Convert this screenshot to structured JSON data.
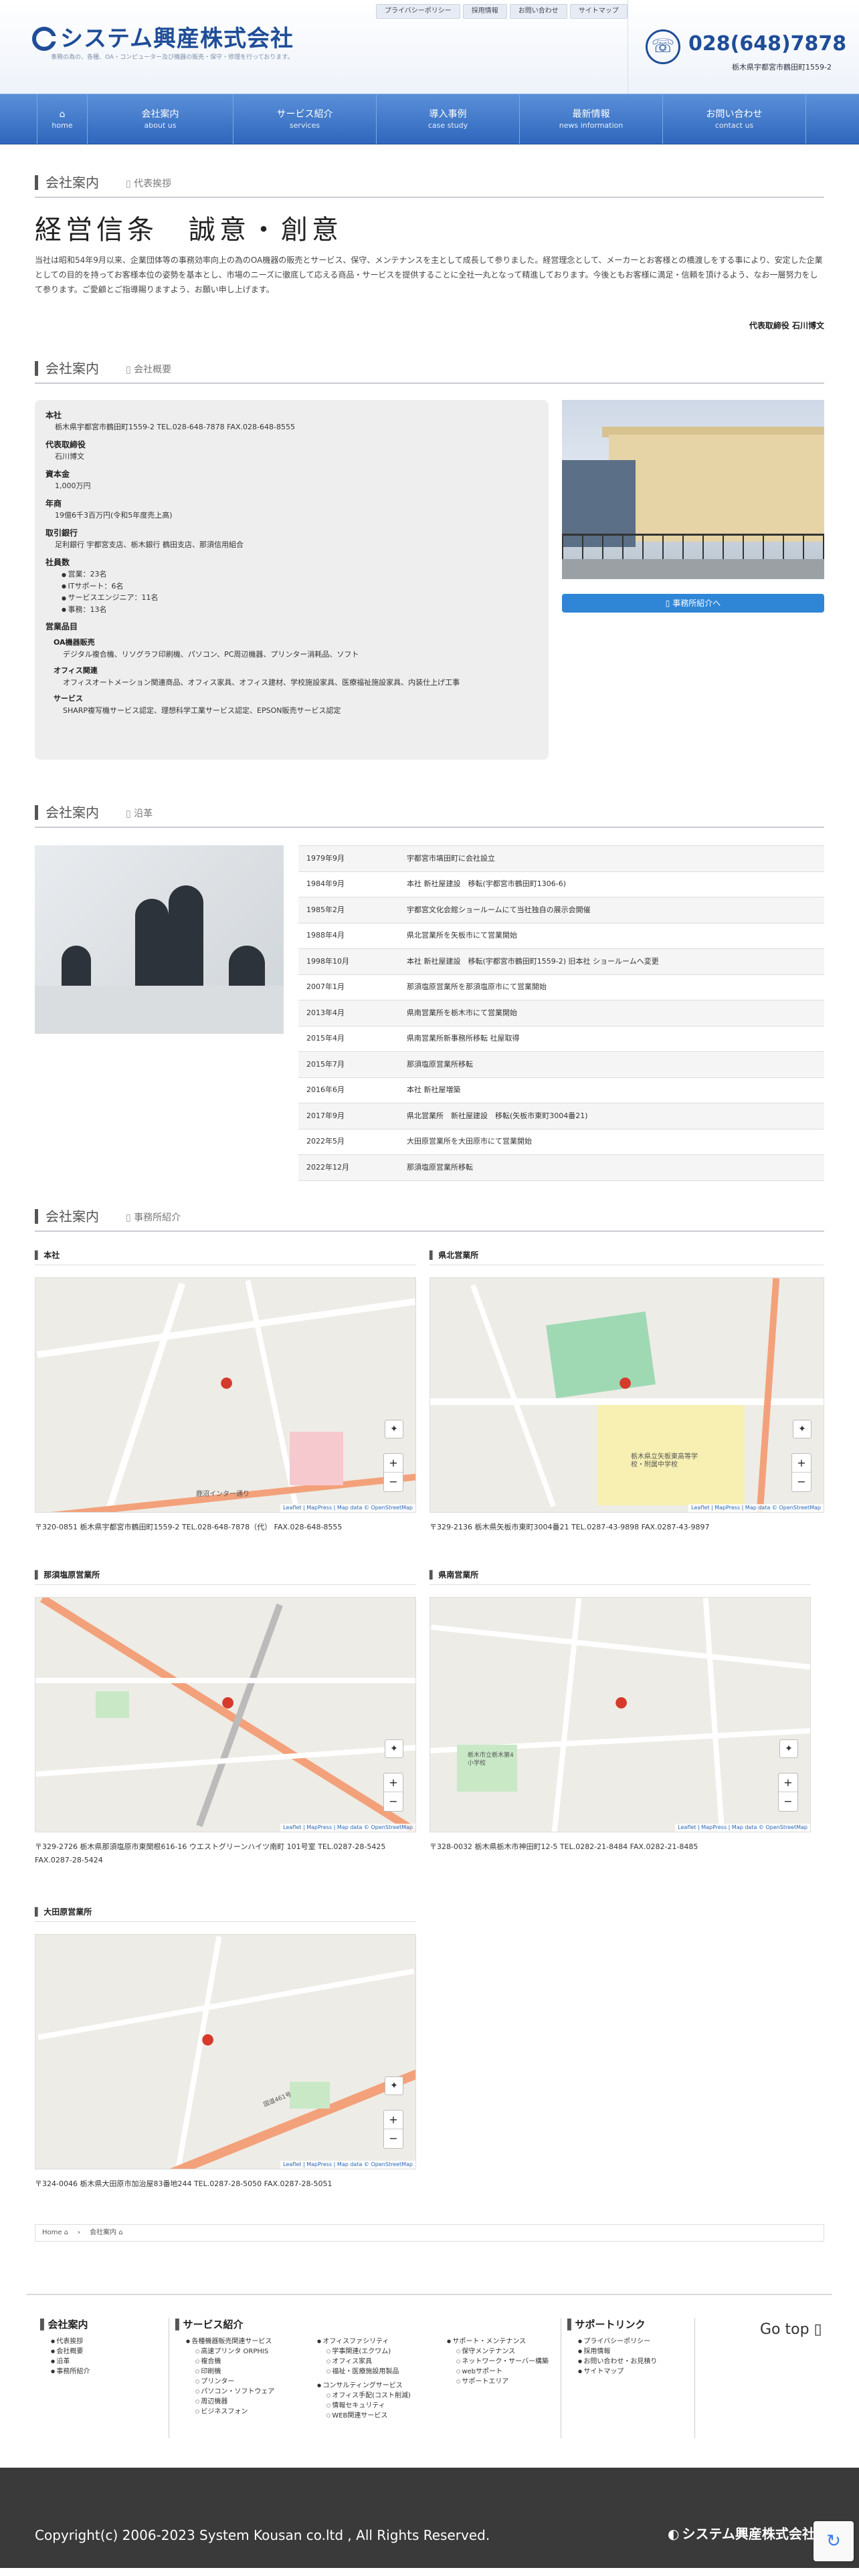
{
  "header": {
    "logo_text": "システム興産株式会社",
    "tagline": "事務の為の、各種、OA・コンピューター及び機器の販売・保守・修理を行っております。",
    "util_nav": [
      "プライバシーポリシー",
      "採用情報",
      "お問い合わせ",
      "サイトマップ"
    ],
    "tel_number": "028(648)7878",
    "tel_address": "栃木県宇都宮市鶴田町1559-2"
  },
  "gnav": [
    {
      "jp": "",
      "en": "home"
    },
    {
      "jp": "会社案内",
      "en": "about us"
    },
    {
      "jp": "サービス紹介",
      "en": "services"
    },
    {
      "jp": "導入事例",
      "en": "case study"
    },
    {
      "jp": "最新情報",
      "en": "news information"
    },
    {
      "jp": "お問い合わせ",
      "en": "contact us"
    }
  ],
  "greeting": {
    "heading": "会社案内",
    "sub": "代表挨拶",
    "motto": "経営信条　誠意・創意",
    "body": "当社は昭和54年9月以来、企業団体等の事務効率向上の為のOA機器の販売とサービス、保守、メンテナンスを主として成長して参りました。経営理念として、メーカーとお客様との橋渡しをする事により、安定した企業としての目的を持ってお客様本位の姿勢を基本とし、市場のニーズに徹底して応える商品・サービスを提供することに全社一丸となって精進しております。今後ともお客様に満足・信頼を頂けるよう、なお一層努力をして参ります。ご愛顧とご指導賜りますよう、お願い申し上げます。",
    "signature": "代表取締役 石川博文"
  },
  "profile": {
    "heading": "会社案内",
    "sub": "会社概要",
    "head_office_label": "本社",
    "head_office": "栃木県宇都宮市鶴田町1559-2 TEL.028-648-7878 FAX.028-648-8555",
    "ceo_label": "代表取締役",
    "ceo": "石川博文",
    "capital_label": "資本金",
    "capital": "1,000万円",
    "sales_label": "年商",
    "sales": "19億6千3百万円(令和5年度売上高)",
    "banks_label": "取引銀行",
    "banks": "足利銀行 宇都宮支店、栃木銀行 鶴田支店、那須信用組合",
    "staff_label": "社員数",
    "staff": [
      "営業：23名",
      "ITサポート：6名",
      "サービスエンジニア：11名",
      "事務：13名"
    ],
    "products_label": "営業品目",
    "oa_label": "OA機器販売",
    "oa": "デジタル複合機、リソグラフ印刷機、パソコン、PC周辺機器、プリンター消耗品、ソフト",
    "office_label": "オフィス関連",
    "office": "オフィスオートメーション関連商品、オフィス家具、オフィス建材、学校施設家具、医療福祉施設家具、内装仕上げ工事",
    "service_label": "サービス",
    "service": "SHARP複写機サービス認定、理想科学工業サービス認定、EPSON販売サービス認定",
    "office_button": "▯ 事務所紹介へ"
  },
  "history": {
    "heading": "会社案内",
    "sub": "沿革",
    "rows": [
      {
        "date": "1979年9月",
        "event": "宇都宮市塙田町に会社設立"
      },
      {
        "date": "1984年9月",
        "event": "本社 新社屋建設　移転(宇都宮市鶴田町1306-6)"
      },
      {
        "date": "1985年2月",
        "event": "宇都宮文化会館ショールームにて当社独自の展示会開催"
      },
      {
        "date": "1988年4月",
        "event": "県北営業所を矢板市にて営業開始"
      },
      {
        "date": "1998年10月",
        "event": "本社 新社屋建設　移転(宇都宮市鶴田町1559-2) 旧本社 ショールームへ変更"
      },
      {
        "date": "2007年1月",
        "event": "那須塩原営業所を那須塩原市にて営業開始"
      },
      {
        "date": "2013年4月",
        "event": "県南営業所を栃木市にて営業開始"
      },
      {
        "date": "2015年4月",
        "event": "県南営業所新事務所移転 社屋取得"
      },
      {
        "date": "2015年7月",
        "event": "那須塩原営業所移転"
      },
      {
        "date": "2016年6月",
        "event": "本社 新社屋増築"
      },
      {
        "date": "2017年9月",
        "event": "県北営業所　新社屋建設　移転(矢板市東町3004番21)"
      },
      {
        "date": "2022年5月",
        "event": "大田原営業所を大田原市にて営業開始"
      },
      {
        "date": "2022年12月",
        "event": "那須塩原営業所移転"
      }
    ]
  },
  "offices": {
    "heading": "会社案内",
    "sub": "事務所紹介",
    "attribution": "Leaflet | MapPress | Map data © OpenStreetMap",
    "items": [
      {
        "name": "本社",
        "address": "〒320-0851 栃木県宇都宮市鶴田町1559-2 TEL.028-648-7878（代） FAX.028-648-8555",
        "road_label": "鹿沼インター通り"
      },
      {
        "name": "県北営業所",
        "address": "〒329-2136 栃木県矢板市東町3004番21 TEL.0287-43-9898 FAX.0287-43-9897",
        "road_label": "栃木県立矢板東高等学校・附属中学校"
      },
      {
        "name": "那須塩原営業所",
        "address": "〒329-2726 栃木県那須塩原市東関根616-16 ウエストグリーンハイツ南町 101号室 TEL.0287-28-5425 FAX.0287-28-5424",
        "road_label": ""
      },
      {
        "name": "県南営業所",
        "address": "〒328-0032 栃木県栃木市神田町12-5 TEL.0282-21-8484 FAX.0282-21-8485",
        "road_label": "栃木市立栃木第4小学校"
      },
      {
        "name": "大田原営業所",
        "address": "〒324-0046 栃木県大田原市加治屋83番地244 TEL.0287-28-5050 FAX.0287-28-5051",
        "road_label": "国道461号"
      }
    ]
  },
  "breadcrumb": [
    "Home",
    "会社案内"
  ],
  "footer": {
    "col1_title": "会社案内",
    "col1": [
      "代表挨拶",
      "会社概要",
      "沿革",
      "事務所紹介"
    ],
    "col2_title": "サービス紹介",
    "col2a_title": "各種機器販売関連サービス",
    "col2a": [
      "高速プリンタ ORPHIS",
      "複合機",
      "印刷機",
      "プリンター",
      "パソコン・ソフトウェア",
      "周辺機器",
      "ビジネスフォン"
    ],
    "col2b_title": "オフィスファシリティ",
    "col2b": [
      "学事関連(エクワム)",
      "オフィス家具",
      "福祉・医療施設用製品"
    ],
    "col2c_title": "コンサルティングサービス",
    "col2c": [
      "オフィス手配(コスト削減)",
      "情報セキュリティ",
      "WEB関連サービス"
    ],
    "col2d_title": "サポート・メンテナンス",
    "col2d": [
      "保守メンテナンス",
      "ネットワーク・サーバー構築",
      "webサポート",
      "サポートエリア"
    ],
    "col3_title": "サポートリンク",
    "col3": [
      "プライバシーポリシー",
      "採用情報",
      "お問い合わせ・お見積り",
      "サイトマップ"
    ],
    "go_top": "Go top ▯",
    "copyright": "Copyright(c) 2006-2023 System Kousan co.ltd , All Rights Reserved.",
    "footer_logo": "システム興産株式会社"
  }
}
